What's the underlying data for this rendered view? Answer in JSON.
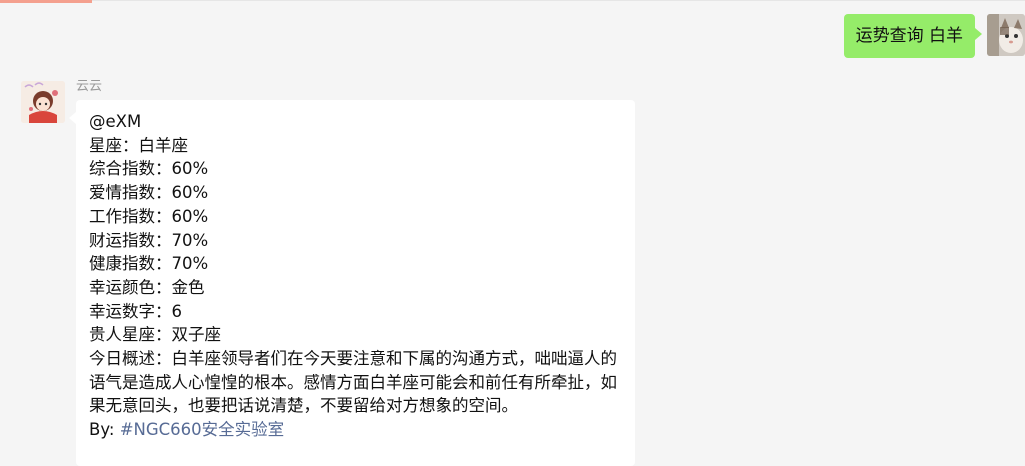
{
  "outgoing": {
    "text": "运势查询 白羊"
  },
  "incoming": {
    "sender": "云云",
    "mention": "@eXM",
    "lines": [
      "星座：白羊座",
      "综合指数：60%",
      "爱情指数：60%",
      "工作指数：60%",
      "财运指数：70%",
      "健康指数：70%",
      "幸运颜色：金色",
      "幸运数字：6",
      "贵人星座：双子座"
    ],
    "summary": "今日概述：白羊座领导者们在今天要注意和下属的沟通方式，咄咄逼人的语气是造成人心惶惶的根本。感情方面白羊座可能会和前任有所牵扯，如果无意回头，也要把话说清楚，不要留给对方想象的空间。",
    "by_label": "By: ",
    "by_link": "#NGC660安全实验室"
  },
  "colors": {
    "outgoing_bubble": "#95ec69",
    "incoming_bubble": "#ffffff",
    "background": "#f5f5f5",
    "link": "#576b95"
  }
}
